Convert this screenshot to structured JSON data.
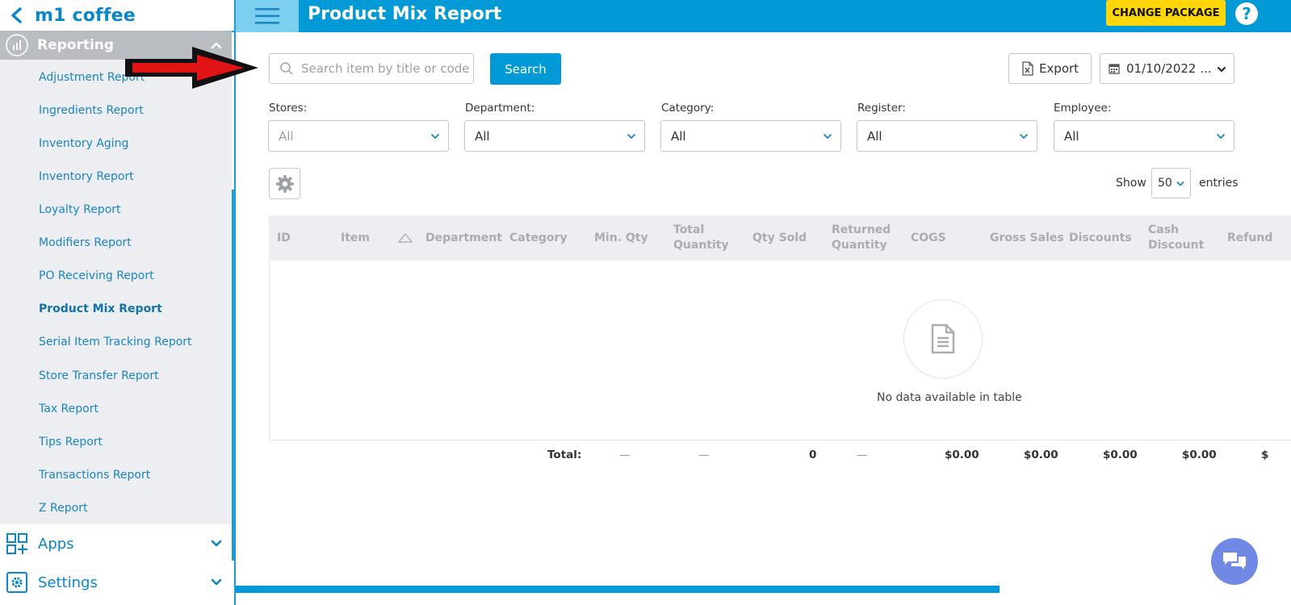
{
  "sidebar": {
    "brand": "m1 coffee",
    "section": "Reporting",
    "items": [
      "Adjustment Report",
      "Ingredients Report",
      "Inventory Aging",
      "Inventory Report",
      "Loyalty Report",
      "Modifiers Report",
      "PO Receiving Report",
      "Product Mix Report",
      "Serial Item Tracking Report",
      "Store Transfer Report",
      "Tax Report",
      "Tips Report",
      "Transactions Report",
      "Z Report"
    ],
    "active_item": "Product Mix Report",
    "apps": "Apps",
    "settings": "Settings"
  },
  "header": {
    "title": "Product Mix Report",
    "change_package": "CHANGE PACKAGE",
    "help": "?"
  },
  "toolbar": {
    "search_placeholder": "Search item by title or code",
    "search_button": "Search",
    "export": "Export",
    "date": "01/10/2022 ..."
  },
  "filters": [
    {
      "label": "Stores:",
      "value": "All"
    },
    {
      "label": "Department:",
      "value": "All"
    },
    {
      "label": "Category:",
      "value": "All"
    },
    {
      "label": "Register:",
      "value": "All"
    },
    {
      "label": "Employee:",
      "value": "All"
    }
  ],
  "entries": {
    "show": "Show",
    "value": "50",
    "label": "entries"
  },
  "table": {
    "columns": [
      "ID",
      "Item",
      "Department",
      "Category",
      "Min. Qty",
      "Total|Quantity",
      "Qty Sold",
      "Returned|Quantity",
      "COGS",
      "Gross Sales",
      "Discounts",
      "Cash|Discount",
      "Refund"
    ],
    "empty": "No data available in table",
    "totals": {
      "label": "Total:",
      "min_qty": "—",
      "total_qty": "—",
      "qty_sold": "0",
      "returned": "—",
      "cogs": "$0.00",
      "gross_sales": "$0.00",
      "discounts": "$0.00",
      "cash_discount": "$0.00",
      "refund": "$"
    }
  },
  "colors": {
    "primary": "#029ad6",
    "accent": "#ffd60a",
    "sidebar_bg": "#eceef1",
    "chat": "#7188e4"
  },
  "icons": [
    "back-icon",
    "reporting-icon",
    "chevron-up-icon",
    "apps-icon",
    "settings-icon",
    "menu-icon",
    "search-icon",
    "excel-icon",
    "calendar-icon",
    "gear-icon",
    "sort-icon",
    "document-icon",
    "chat-icon",
    "arrow-annotation"
  ]
}
